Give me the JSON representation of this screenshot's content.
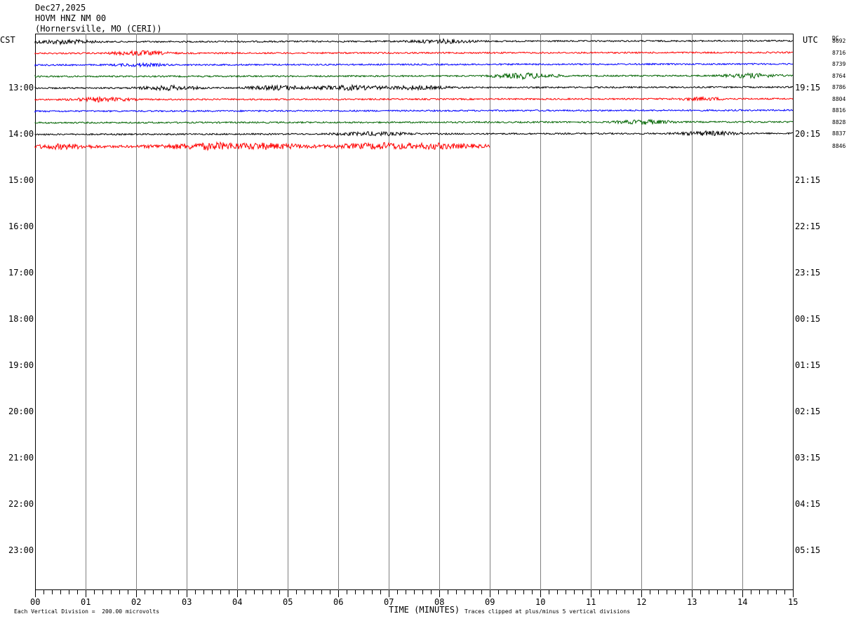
{
  "header": {
    "date": "Dec27,2025",
    "station": "HOVM HNZ NM 00",
    "location": "(Hornersville, MO (CERI))"
  },
  "labels": {
    "left_tz": "CST",
    "right_tz": "UTC",
    "dc": "DC",
    "xlabel": "TIME (MINUTES)",
    "scale_note": "Each Vertical Division =  200.00 microvolts",
    "clip_note": "Traces clipped at plus/minus 5 vertical divisions"
  },
  "chart_data": {
    "type": "line",
    "title": "HOVM HNZ NM 00",
    "xlabel": "TIME (MINUTES)",
    "xlim": [
      0,
      15
    ],
    "x_ticks": [
      "00",
      "01",
      "02",
      "03",
      "04",
      "05",
      "06",
      "07",
      "08",
      "09",
      "10",
      "11",
      "12",
      "13",
      "14",
      "15"
    ],
    "left_hour_labels": [
      "13:00",
      "14:00",
      "15:00",
      "16:00",
      "17:00",
      "18:00",
      "19:00",
      "20:00",
      "21:00",
      "22:00",
      "23:00"
    ],
    "right_hour_labels": [
      "19:15",
      "20:15",
      "21:15",
      "22:15",
      "23:15",
      "00:15",
      "01:15",
      "02:15",
      "03:15",
      "04:15",
      "05:15"
    ],
    "trace_colors": [
      "#000000",
      "#ff0000",
      "#0000ff",
      "#006400"
    ],
    "traces": [
      {
        "dc": "8692",
        "color": "#000000",
        "x_end": 15
      },
      {
        "dc": "8716",
        "color": "#ff0000",
        "x_end": 15
      },
      {
        "dc": "8739",
        "color": "#0000ff",
        "x_end": 15
      },
      {
        "dc": "8764",
        "color": "#006400",
        "x_end": 15
      },
      {
        "dc": "8786",
        "color": "#000000",
        "x_end": 15
      },
      {
        "dc": "8804",
        "color": "#ff0000",
        "x_end": 15
      },
      {
        "dc": "8816",
        "color": "#0000ff",
        "x_end": 15
      },
      {
        "dc": "8828",
        "color": "#006400",
        "x_end": 15
      },
      {
        "dc": "8837",
        "color": "#000000",
        "x_end": 15
      },
      {
        "dc": "8846",
        "color": "#ff0000",
        "x_end": 9
      }
    ]
  }
}
